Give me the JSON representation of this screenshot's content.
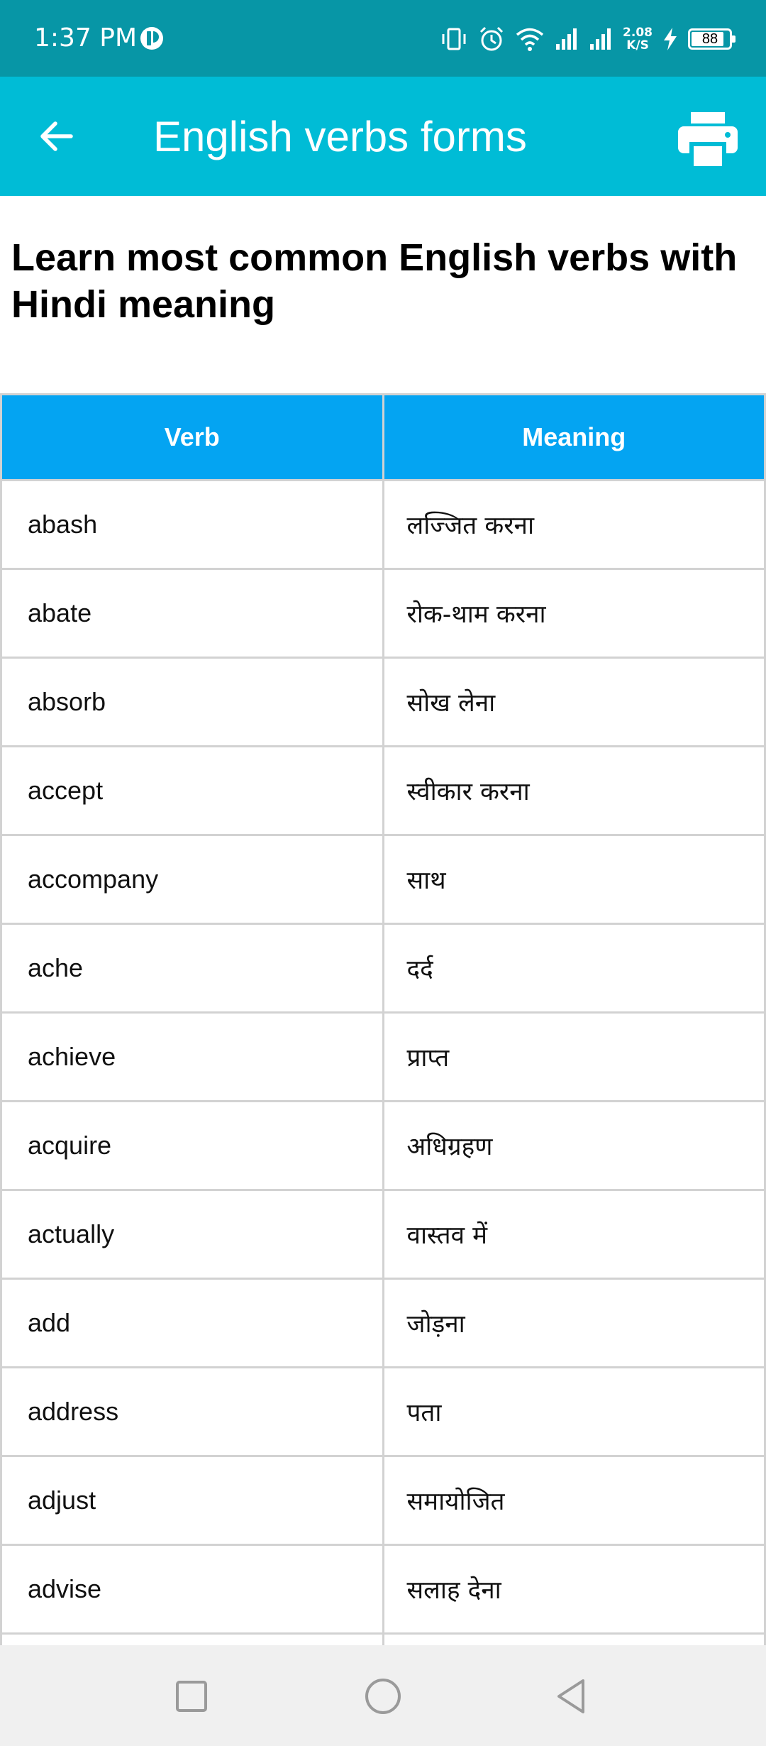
{
  "status_bar": {
    "time": "1:37 PM",
    "net_speed_value": "2.08",
    "net_speed_unit": "K/S",
    "battery_level": "88",
    "icons": [
      "app-notification-icon",
      "vibrate-icon",
      "alarm-icon",
      "wifi-icon",
      "signal-icon",
      "signal-icon",
      "charging-icon",
      "battery-icon"
    ]
  },
  "app_bar": {
    "title": "English verbs forms",
    "back_icon": "arrow-left-icon",
    "print_icon": "printer-icon"
  },
  "heading": "Learn most common English verbs with Hindi meaning",
  "table": {
    "columns": [
      "Verb",
      "Meaning"
    ],
    "rows": [
      {
        "verb": "abash",
        "meaning": "लज्जित करना"
      },
      {
        "verb": "abate",
        "meaning": "रोक-थाम करना"
      },
      {
        "verb": "absorb",
        "meaning": "सोख लेना"
      },
      {
        "verb": "accept",
        "meaning": "स्वीकार करना"
      },
      {
        "verb": "accompany",
        "meaning": "साथ"
      },
      {
        "verb": "ache",
        "meaning": "दर्द"
      },
      {
        "verb": "achieve",
        "meaning": "प्राप्त"
      },
      {
        "verb": "acquire",
        "meaning": "अधिग्रहण"
      },
      {
        "verb": "actually",
        "meaning": "वास्तव में"
      },
      {
        "verb": "add",
        "meaning": "जोड़ना"
      },
      {
        "verb": "address",
        "meaning": "पता"
      },
      {
        "verb": "adjust",
        "meaning": "समायोजित"
      },
      {
        "verb": "advise",
        "meaning": "सलाह देना"
      }
    ]
  },
  "colors": {
    "status_bar": "#0796a6",
    "app_bar": "#00bcd6",
    "table_header": "#04a4f2",
    "nav_bar": "#f0f0f0"
  },
  "nav_bar": {
    "icons": [
      "square-icon",
      "circle-icon",
      "triangle-back-icon"
    ]
  }
}
